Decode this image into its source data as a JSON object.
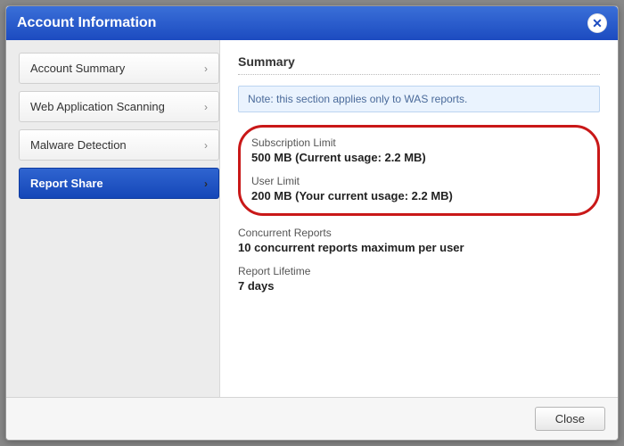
{
  "dialog": {
    "title": "Account Information",
    "close_button_label": "Close"
  },
  "sidebar": {
    "items": [
      {
        "label": "Account Summary",
        "active": false
      },
      {
        "label": "Web Application Scanning",
        "active": false
      },
      {
        "label": "Malware Detection",
        "active": false
      },
      {
        "label": "Report Share",
        "active": true
      }
    ]
  },
  "main": {
    "section_title": "Summary",
    "note": "Note: this section applies only to WAS reports.",
    "fields": {
      "subscription_limit": {
        "label": "Subscription Limit",
        "value": "500 MB (Current usage: 2.2 MB)"
      },
      "user_limit": {
        "label": "User Limit",
        "value": "200 MB (Your current usage: 2.2 MB)"
      },
      "concurrent_reports": {
        "label": "Concurrent Reports",
        "value": "10 concurrent reports maximum per user"
      },
      "report_lifetime": {
        "label": "Report Lifetime",
        "value": "7 days"
      }
    }
  }
}
